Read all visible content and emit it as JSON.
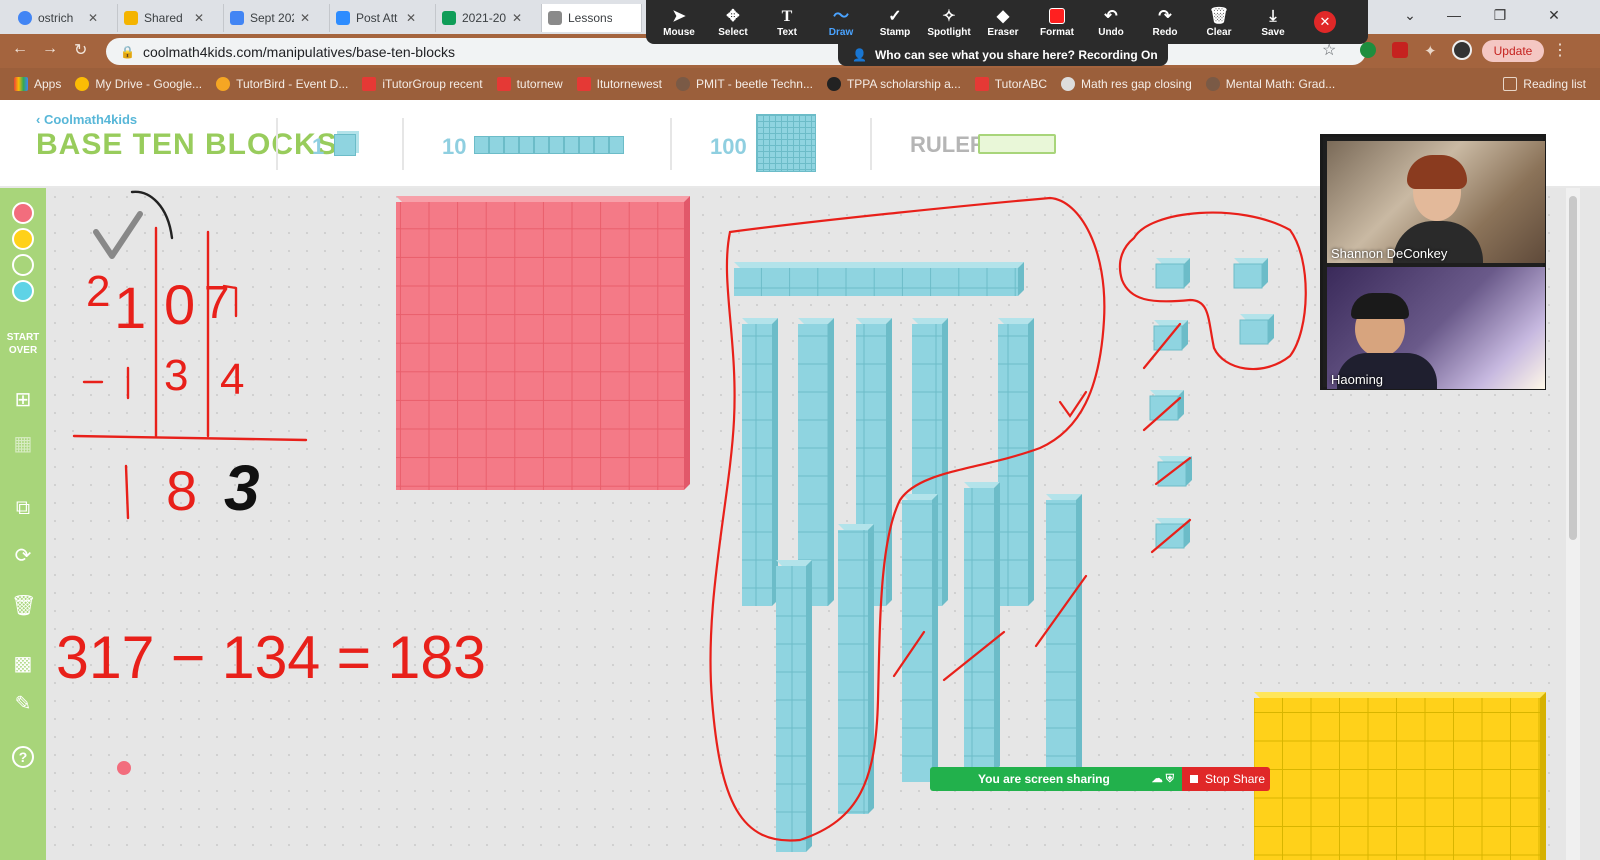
{
  "browser": {
    "tabs": [
      {
        "title": "ostrich",
        "color": "#4285f4"
      },
      {
        "title": "Shared",
        "color": "#f4b400"
      },
      {
        "title": "Sept 202",
        "color": "#4285f4"
      },
      {
        "title": "Post Att",
        "color": "#2d8cff"
      },
      {
        "title": "2021-20",
        "color": "#0f9d58"
      },
      {
        "title": "Lessons",
        "color": "#8a8a8a"
      }
    ],
    "url": "coolmath4kids.com/manipulatives/base-ten-blocks",
    "update_label": "Update",
    "bookmarks": [
      "Apps",
      "My Drive - Google...",
      "TutorBird - Event D...",
      "iTutorGroup recent",
      "tutornew",
      "Itutornewest",
      "PMIT - beetle Techn...",
      "TPPA scholarship a...",
      "TutorABC",
      "Math res gap closing",
      "Mental Math: Grad..."
    ],
    "reading_list": "Reading list"
  },
  "zoom_toolbar": {
    "tools": [
      "Mouse",
      "Select",
      "Text",
      "Draw",
      "Stamp",
      "Spotlight",
      "Eraser",
      "Format",
      "Undo",
      "Redo",
      "Clear",
      "Save"
    ],
    "active_tool": "Draw",
    "recording_text": "Who can see what you share here? Recording On"
  },
  "app": {
    "brand": "Coolmath4kids",
    "title": "BASE TEN BLOCKS",
    "block_labels": [
      "1",
      "10",
      "100"
    ],
    "ruler_label": "RULER",
    "sidebar": {
      "colors": [
        "#f26d7d",
        "#ffd11a",
        "#a8d57a",
        "#5fd3e6"
      ],
      "start_over": "START OVER"
    }
  },
  "canvas": {
    "handwriting": {
      "digits_top": [
        "2",
        "1",
        "0",
        "7"
      ],
      "digits_sub": [
        "-",
        "1",
        "3",
        "4"
      ],
      "result": [
        "1",
        "8",
        "3"
      ],
      "equation": "317 − 134 = 183"
    }
  },
  "video": {
    "participants": [
      "Shannon DeConkey",
      "Haoming"
    ]
  },
  "share": {
    "status": "You are screen sharing",
    "stop_label": "Stop Share"
  }
}
